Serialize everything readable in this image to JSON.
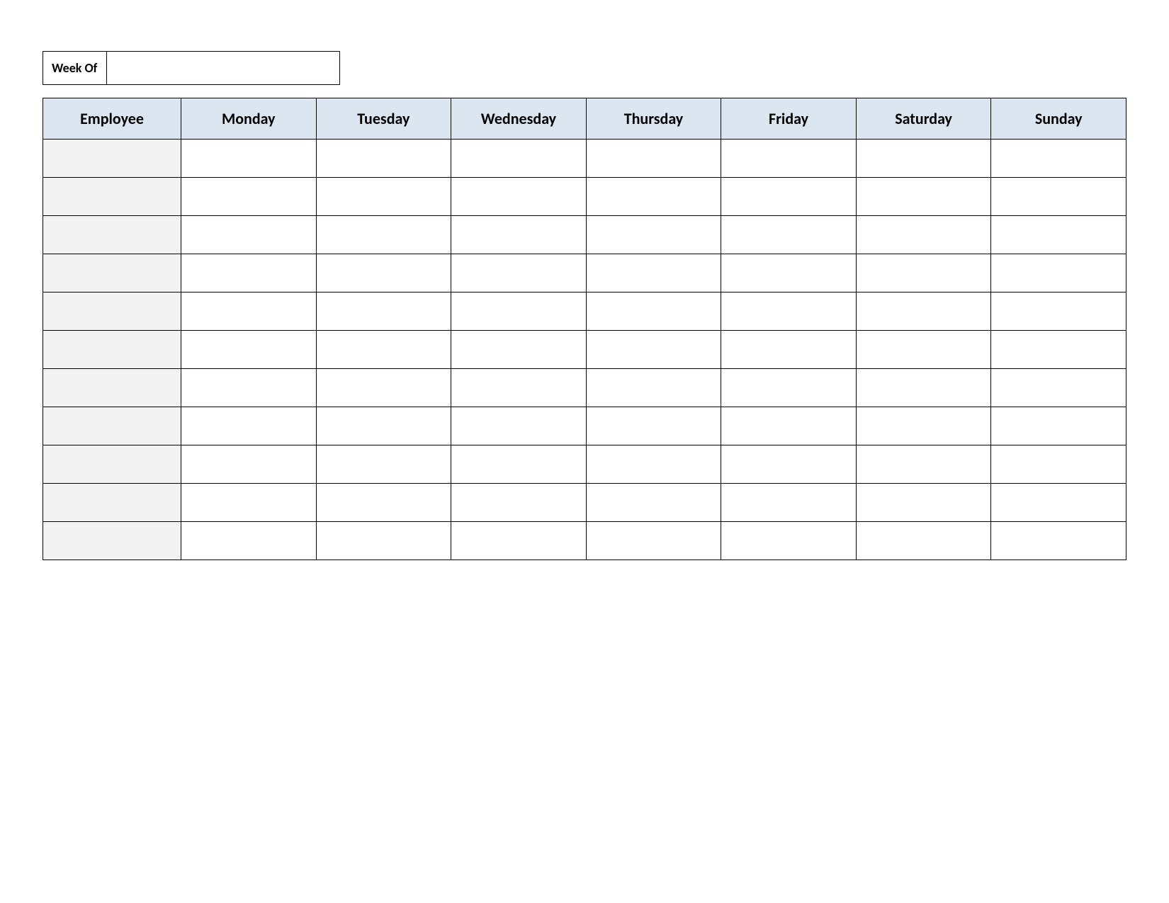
{
  "weekof": {
    "label": "Week Of",
    "value": ""
  },
  "headers": {
    "employee": "Employee",
    "days": [
      "Monday",
      "Tuesday",
      "Wednesday",
      "Thursday",
      "Friday",
      "Saturday",
      "Sunday"
    ]
  },
  "rows": [
    {
      "employee": "",
      "cells": [
        "",
        "",
        "",
        "",
        "",
        "",
        ""
      ]
    },
    {
      "employee": "",
      "cells": [
        "",
        "",
        "",
        "",
        "",
        "",
        ""
      ]
    },
    {
      "employee": "",
      "cells": [
        "",
        "",
        "",
        "",
        "",
        "",
        ""
      ]
    },
    {
      "employee": "",
      "cells": [
        "",
        "",
        "",
        "",
        "",
        "",
        ""
      ]
    },
    {
      "employee": "",
      "cells": [
        "",
        "",
        "",
        "",
        "",
        "",
        ""
      ]
    },
    {
      "employee": "",
      "cells": [
        "",
        "",
        "",
        "",
        "",
        "",
        ""
      ]
    },
    {
      "employee": "",
      "cells": [
        "",
        "",
        "",
        "",
        "",
        "",
        ""
      ]
    },
    {
      "employee": "",
      "cells": [
        "",
        "",
        "",
        "",
        "",
        "",
        ""
      ]
    },
    {
      "employee": "",
      "cells": [
        "",
        "",
        "",
        "",
        "",
        "",
        ""
      ]
    },
    {
      "employee": "",
      "cells": [
        "",
        "",
        "",
        "",
        "",
        "",
        ""
      ]
    },
    {
      "employee": "",
      "cells": [
        "",
        "",
        "",
        "",
        "",
        "",
        ""
      ]
    }
  ],
  "colors": {
    "header_bg": "#dce6f1",
    "employee_col_bg": "#f2f2f2",
    "border": "#000000"
  }
}
